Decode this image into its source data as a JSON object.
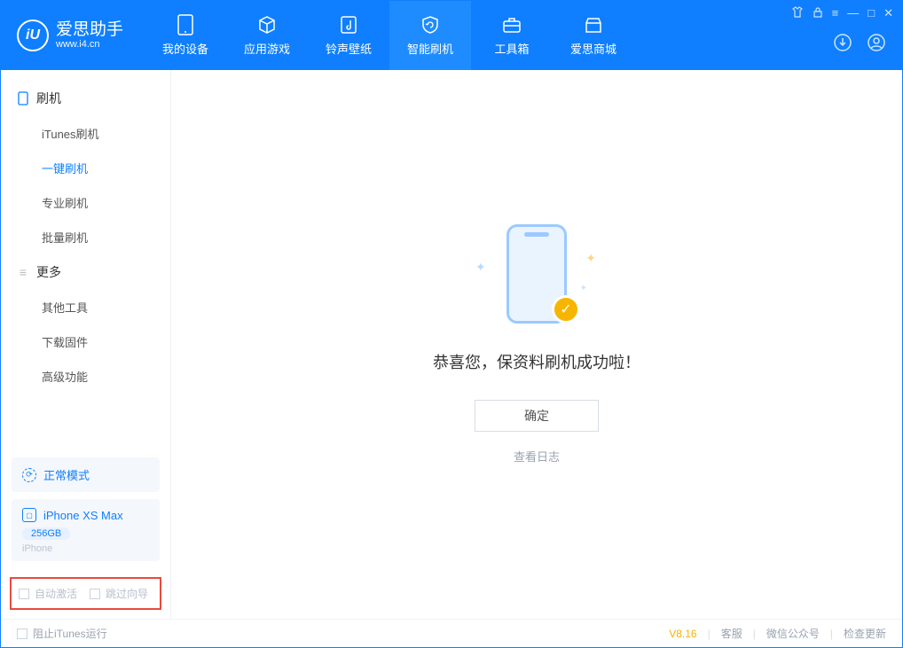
{
  "app": {
    "name": "爱思助手",
    "url": "www.i4.cn"
  },
  "tabs": {
    "device": "我的设备",
    "apps": "应用游戏",
    "ring": "铃声壁纸",
    "flash": "智能刷机",
    "tool": "工具箱",
    "store": "爱思商城"
  },
  "sidebar": {
    "flash": {
      "title": "刷机",
      "items": [
        "iTunes刷机",
        "一键刷机",
        "专业刷机",
        "批量刷机"
      ],
      "activeIndex": 1
    },
    "more": {
      "title": "更多",
      "items": [
        "其他工具",
        "下载固件",
        "高级功能"
      ]
    }
  },
  "mode": {
    "label": "正常模式"
  },
  "device": {
    "name": "iPhone XS Max",
    "capacity": "256GB",
    "type": "iPhone"
  },
  "options": {
    "autoActivate": "自动激活",
    "skipGuide": "跳过向导"
  },
  "main": {
    "success": "恭喜您，保资料刷机成功啦！",
    "ok": "确定",
    "viewLog": "查看日志"
  },
  "footer": {
    "blockItunes": "阻止iTunes运行",
    "version": "V8.16",
    "support": "客服",
    "wechat": "微信公众号",
    "update": "检查更新"
  }
}
